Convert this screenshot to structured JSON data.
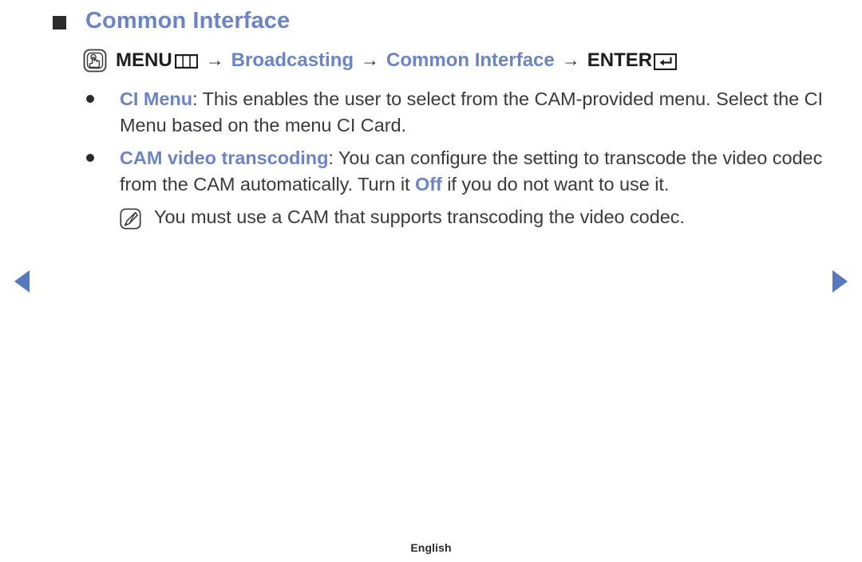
{
  "page": {
    "title": "Common Interface",
    "footer_label": "English",
    "accent_blue": "#6b84c4",
    "arrow_blue": "#5878bd",
    "text_dark": "#3a3a3a",
    "bullet_dark": "#2b2b2b"
  },
  "menu_path": {
    "icon": "menu-press-icon",
    "segments": [
      {
        "text": "MENU",
        "style": "dark",
        "glyph": "menu-bars-icon"
      },
      {
        "text": "Broadcasting",
        "style": "blue",
        "glyph": ""
      },
      {
        "text": "Common Interface",
        "style": "blue",
        "glyph": ""
      },
      {
        "text": "ENTER",
        "style": "dark",
        "glyph": "enter-return-icon"
      }
    ],
    "separator": "→"
  },
  "bullets": [
    {
      "marker": "bullet-dot",
      "keyword": "CI Menu",
      "body": ": This enables the user to select from the CAM-provided menu. Select the CI Menu based on the menu CI Card."
    },
    {
      "marker": "bullet-dot",
      "keyword": "CAM video transcoding",
      "body_part_1": ": You can configure the setting to transcode the video codec from the CAM automatically. Turn it ",
      "emphasis": "Off",
      "body_part_2": " if you do not want to use it."
    }
  ],
  "note": {
    "icon": "note-pencil-icon",
    "text": "You must use a CAM that supports transcoding the video codec."
  },
  "navigation": {
    "prev_icon": "prev-page-arrow-icon",
    "next_icon": "next-page-arrow-icon"
  }
}
